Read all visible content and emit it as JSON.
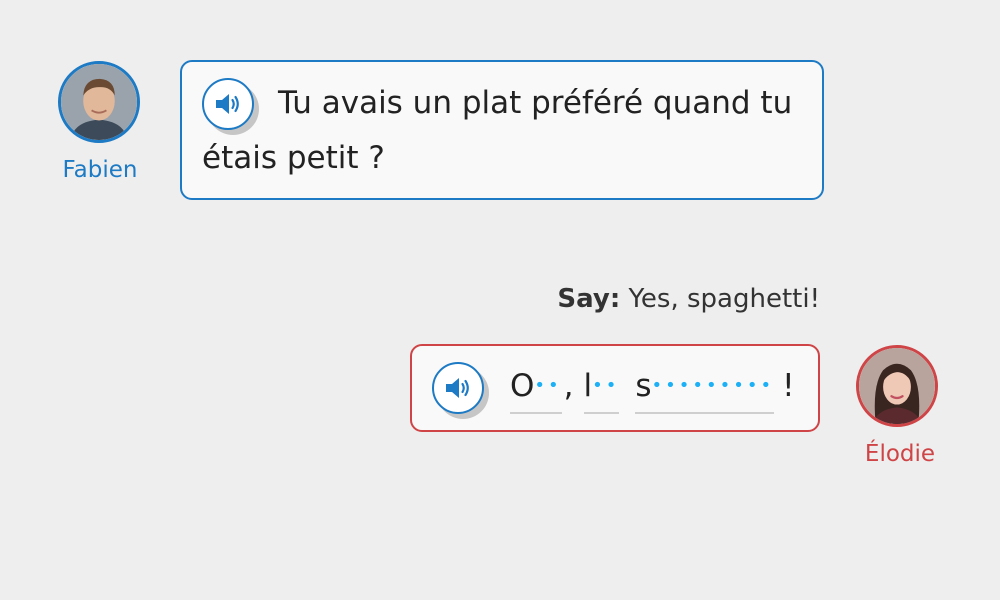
{
  "fabien": {
    "name": "Fabien",
    "message": "Tu avais un plat préféré quand tu étais petit ?",
    "colors": {
      "accent": "#1d7ac4"
    }
  },
  "instruction": {
    "label": "Say:",
    "text": "Yes, spaghetti!"
  },
  "elodie": {
    "name": "Élodie",
    "colors": {
      "accent": "#cf4446"
    },
    "answer": {
      "words": [
        {
          "first_letter": "O",
          "hidden_dots": "••"
        },
        {
          "first_letter": "l",
          "hidden_dots": "••"
        },
        {
          "first_letter": "s",
          "hidden_dots": "•••••••••"
        }
      ],
      "comma": ",",
      "end_punct": "!"
    }
  },
  "colors": {
    "background": "#eeeeee",
    "bubble": "#f9f9f9",
    "dots": "#1cb0f6"
  }
}
